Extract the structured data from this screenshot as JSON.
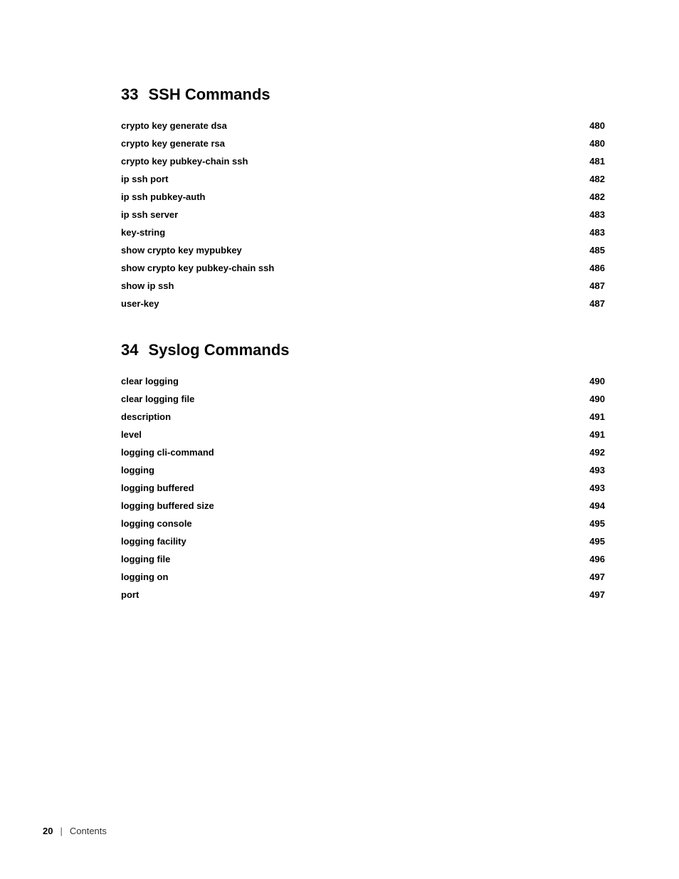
{
  "page": {
    "footer": {
      "page_number": "20",
      "separator": "|",
      "label": "Contents"
    }
  },
  "sections": [
    {
      "id": "section-33",
      "number": "33",
      "title": "SSH Commands",
      "entries": [
        {
          "name": "crypto key generate dsa",
          "page": "480"
        },
        {
          "name": "crypto key generate rsa",
          "page": "480"
        },
        {
          "name": "crypto key pubkey-chain ssh",
          "page": "481"
        },
        {
          "name": "ip ssh port",
          "page": "482"
        },
        {
          "name": "ip ssh pubkey-auth",
          "page": "482"
        },
        {
          "name": "ip ssh server",
          "page": "483"
        },
        {
          "name": "key-string",
          "page": "483"
        },
        {
          "name": "show crypto key mypubkey",
          "page": "485"
        },
        {
          "name": "show crypto key pubkey-chain ssh",
          "page": "486"
        },
        {
          "name": "show ip ssh",
          "page": "487"
        },
        {
          "name": "user-key",
          "page": "487"
        }
      ]
    },
    {
      "id": "section-34",
      "number": "34",
      "title": "Syslog Commands",
      "entries": [
        {
          "name": "clear logging",
          "page": "490"
        },
        {
          "name": "clear logging file",
          "page": "490"
        },
        {
          "name": "description",
          "page": "491"
        },
        {
          "name": "level",
          "page": "491"
        },
        {
          "name": "logging cli-command",
          "page": "492"
        },
        {
          "name": "logging",
          "page": "493"
        },
        {
          "name": "logging buffered",
          "page": "493"
        },
        {
          "name": "logging buffered size",
          "page": "494"
        },
        {
          "name": "logging console",
          "page": "495"
        },
        {
          "name": "logging facility",
          "page": "495"
        },
        {
          "name": "logging file",
          "page": "496"
        },
        {
          "name": "logging on",
          "page": "497"
        },
        {
          "name": "port",
          "page": "497"
        }
      ]
    }
  ]
}
